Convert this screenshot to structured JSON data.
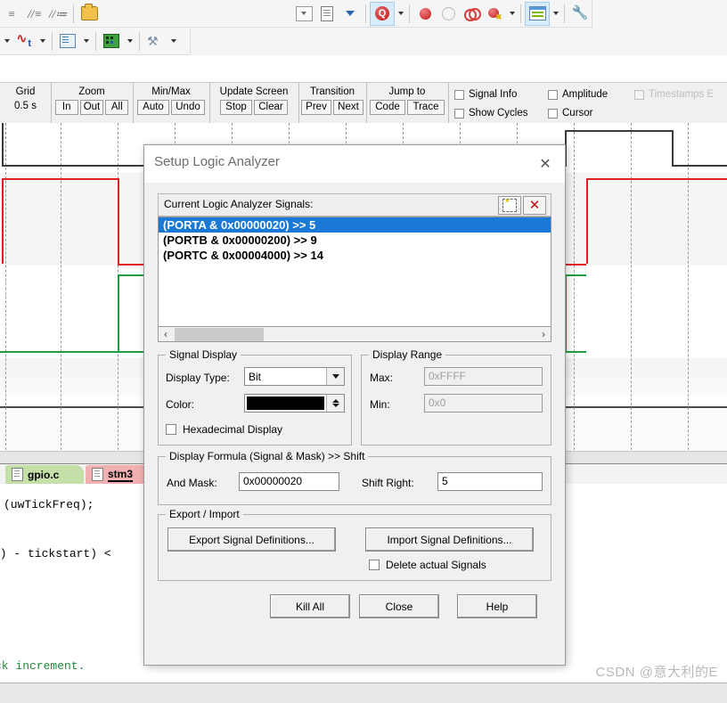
{
  "toolbar": {
    "row1_icons": [
      "indent-lines-icon",
      "indent-lines-2-icon",
      "indent-lines-3-icon",
      "open-folder-icon"
    ],
    "row1_right_icons": [
      "combo-box-icon",
      "document-find-icon",
      "download-arrow-icon",
      "find-in-files-icon"
    ],
    "row1_far_icons": [
      "breakpoint-icon",
      "disabled-breakpoint-icon",
      "toggle-breakpoints-icon",
      "kill-breakpoints-icon",
      "window-layout-icon",
      "configure-wrench-icon"
    ],
    "row2_icons": [
      "logic-analyzer-icon",
      "watch-window-icon",
      "memory-window-icon",
      "tools-icon"
    ]
  },
  "logic_bar": {
    "groups": [
      {
        "title": "Grid",
        "value": "0.5 s",
        "buttons": []
      },
      {
        "title": "Zoom",
        "buttons": [
          "In",
          "Out",
          "All"
        ]
      },
      {
        "title": "Min/Max",
        "buttons": [
          "Auto",
          "Undo"
        ]
      },
      {
        "title": "Update Screen",
        "buttons": [
          "Stop",
          "Clear"
        ]
      },
      {
        "title": "Transition",
        "buttons": [
          "Prev",
          "Next"
        ]
      },
      {
        "title": "Jump to",
        "buttons": [
          "Code",
          "Trace"
        ]
      }
    ],
    "checkboxes": [
      {
        "label": "Signal Info",
        "checked": false,
        "disabled": false
      },
      {
        "label": "Show Cycles",
        "checked": false,
        "disabled": false
      },
      {
        "label": "Amplitude",
        "checked": false,
        "disabled": false
      },
      {
        "label": "Cursor",
        "checked": false,
        "disabled": false
      },
      {
        "label": "Timestamps E",
        "checked": false,
        "disabled": true
      }
    ]
  },
  "waveform": {
    "trace_colors": [
      "#3a3a3a",
      "#e02020",
      "#1f9d40"
    ],
    "gridline_color": "#9a9a9a"
  },
  "editor": {
    "tabs": [
      {
        "label": "gpio.c",
        "active": false
      },
      {
        "label": "stm3",
        "active": true
      }
    ],
    "code_lines": [
      "(uwTickFreq);",
      "() - tickstart) <",
      "ck increment."
    ]
  },
  "watermark": "CSDN @意大利的E",
  "dialog": {
    "title": "Setup Logic Analyzer",
    "close_glyph": "✕",
    "signals_header": "Current Logic Analyzer Signals:",
    "new_button_icon": "new-signal-icon",
    "delete_button_icon": "delete-signal-icon",
    "signals": [
      {
        "text": "(PORTA & 0x00000020) >> 5",
        "selected": true
      },
      {
        "text": "(PORTB & 0x00000200) >> 9",
        "selected": false
      },
      {
        "text": "(PORTC & 0x00004000) >> 14",
        "selected": false
      }
    ],
    "scroll": {
      "left_glyph": "‹",
      "right_glyph": "›"
    },
    "signal_display": {
      "legend": "Signal Display",
      "display_type_label": "Display Type:",
      "display_type_value": "Bit",
      "color_label": "Color:",
      "color_value": "#000000",
      "hex_checkbox_label": "Hexadecimal Display",
      "hex_checked": false
    },
    "display_range": {
      "legend": "Display Range",
      "max_label": "Max:",
      "max_value": "0xFFFF",
      "min_label": "Min:",
      "min_value": "0x0"
    },
    "display_formula": {
      "legend": "Display Formula (Signal & Mask) >> Shift",
      "and_mask_label": "And Mask:",
      "and_mask_value": "0x00000020",
      "shift_right_label": "Shift Right:",
      "shift_right_value": "5"
    },
    "export_import": {
      "legend": "Export / Import",
      "export_button": "Export Signal Definitions...",
      "import_button": "Import Signal Definitions...",
      "delete_checkbox_label": "Delete actual Signals",
      "delete_checked": false
    },
    "footer_buttons": [
      "Kill All",
      "Close",
      "Help"
    ]
  }
}
